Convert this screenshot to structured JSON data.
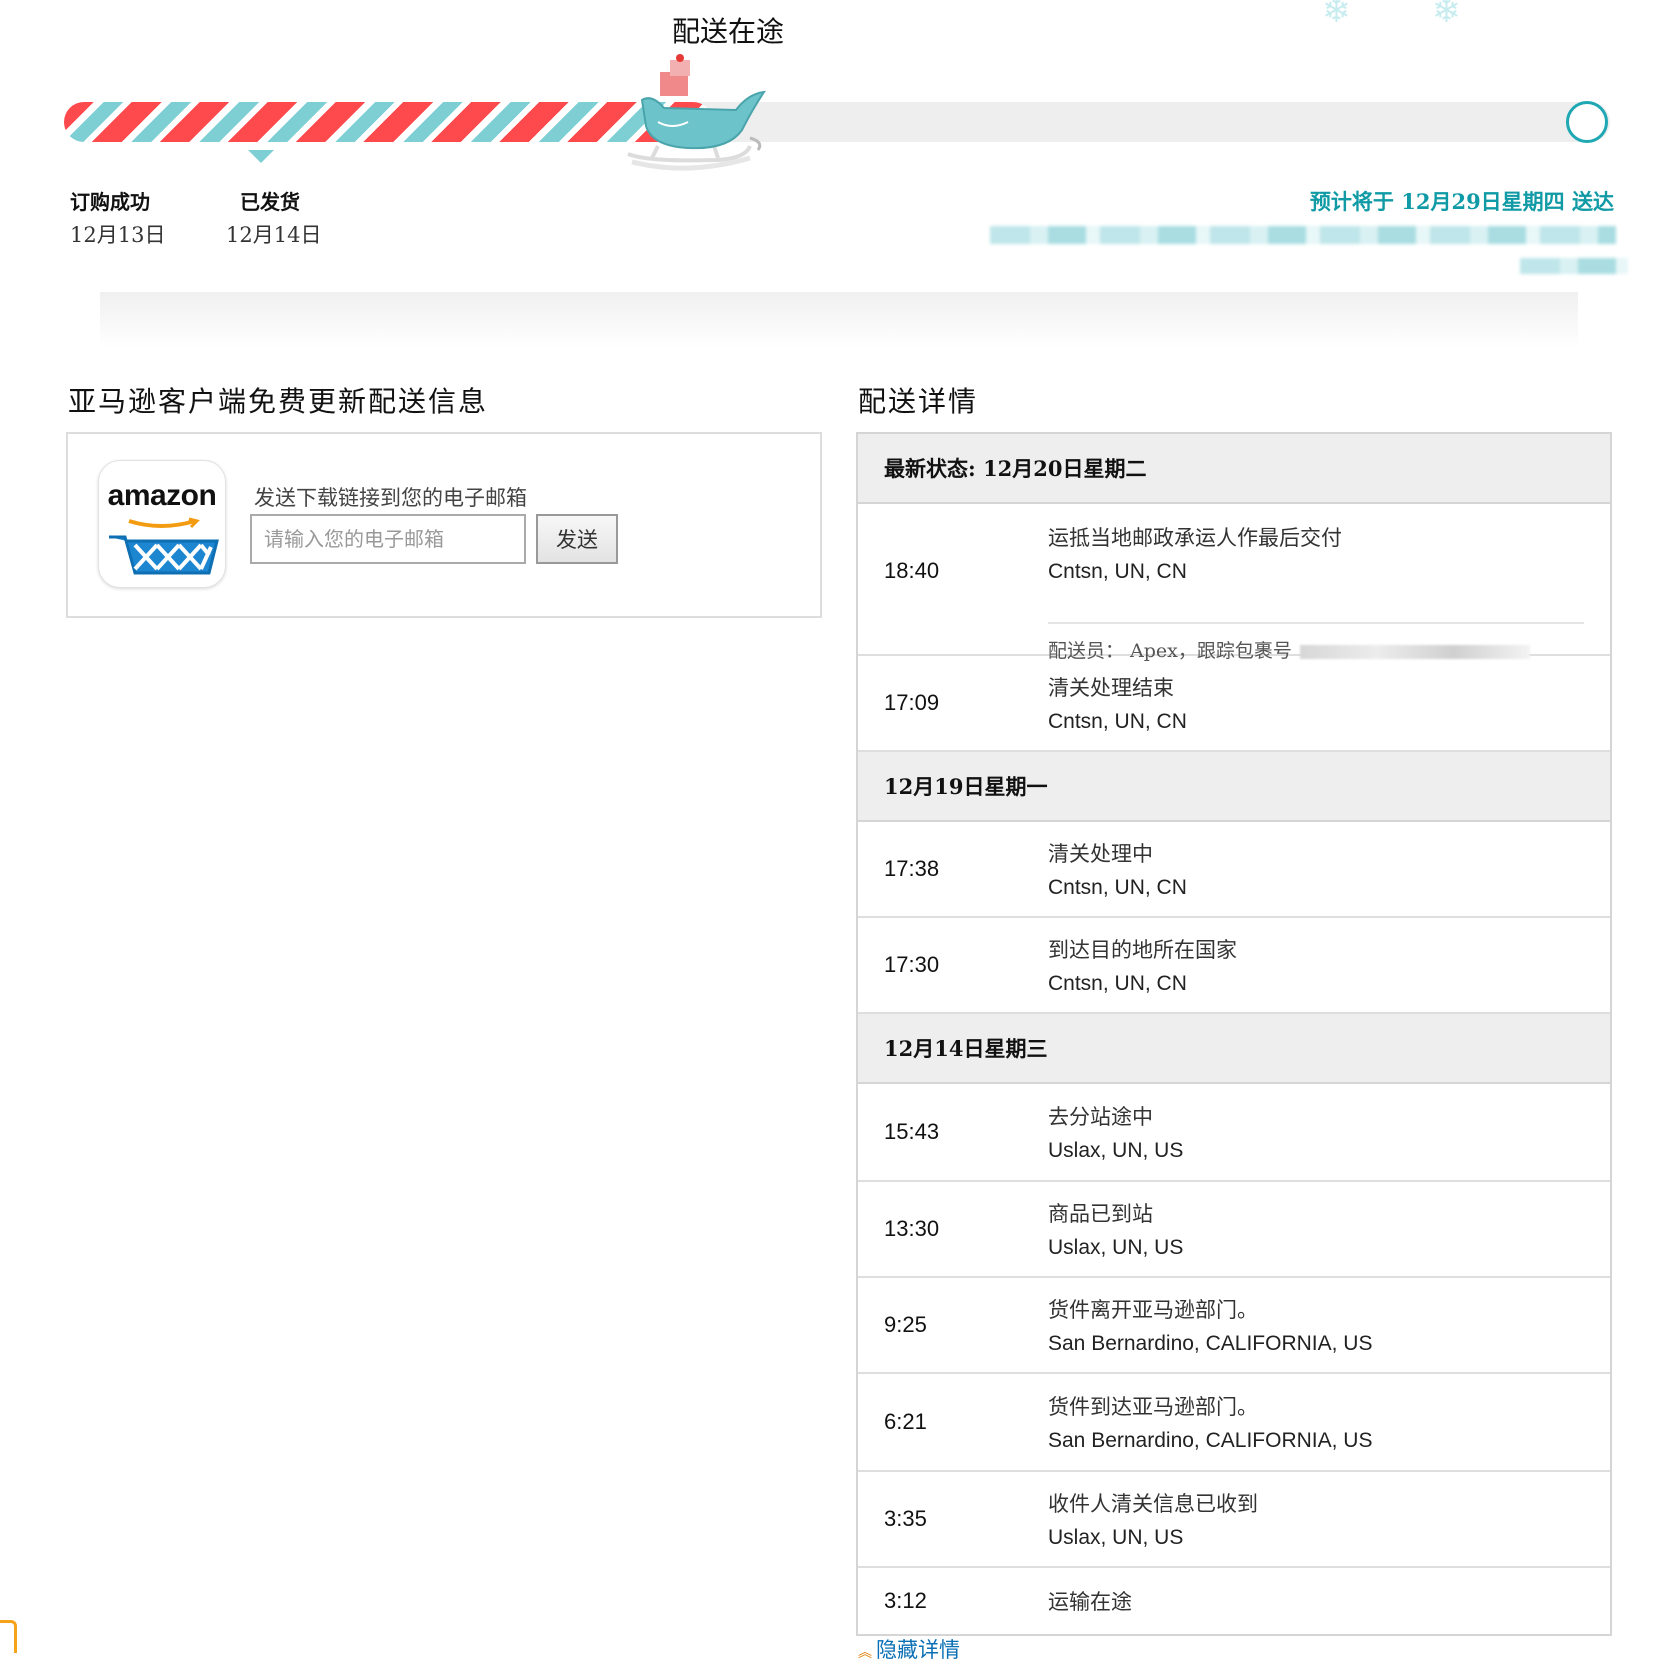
{
  "header": {
    "status_title": "配送在途",
    "progress": 0.42,
    "milestones": [
      {
        "label": "订购成功",
        "date": "12月13日"
      },
      {
        "label": "已发货",
        "date": "12月14日"
      }
    ],
    "eta": "预计将于 12月29日星期四 送达"
  },
  "colors": {
    "stripe_red": "#ff4a4d",
    "stripe_teal": "#7dcfd4",
    "accent_teal": "#0f9aa5",
    "link_blue": "#0a6fb5"
  },
  "app_promo": {
    "title": "亚马逊客户端免费更新配送信息",
    "logo_text": "amazon",
    "email_label": "发送下载链接到您的电子邮箱",
    "email_placeholder": "请输入您的电子邮箱",
    "send_button": "发送"
  },
  "tracking": {
    "title": "配送详情",
    "days": [
      {
        "header": "最新状态: 12月20日星期二",
        "events": [
          {
            "time": "18:40",
            "desc": "运抵当地邮政承运人作最后交付",
            "loc": "Cntsn, UN, CN",
            "courier": "配送员： Apex，跟踪包裹号"
          },
          {
            "time": "17:09",
            "desc": "清关处理结束",
            "loc": "Cntsn, UN, CN"
          }
        ]
      },
      {
        "header": "12月19日星期一",
        "events": [
          {
            "time": "17:38",
            "desc": "清关处理中",
            "loc": "Cntsn, UN, CN"
          },
          {
            "time": "17:30",
            "desc": "到达目的地所在国家",
            "loc": "Cntsn, UN, CN"
          }
        ]
      },
      {
        "header": "12月14日星期三",
        "events": [
          {
            "time": "15:43",
            "desc": "去分站途中",
            "loc": "Uslax, UN, US"
          },
          {
            "time": "13:30",
            "desc": "商品已到站",
            "loc": "Uslax, UN, US"
          },
          {
            "time": "9:25",
            "desc": "货件离开亚马逊部门。",
            "loc": "San Bernardino, CALIFORNIA, US"
          },
          {
            "time": "6:21",
            "desc": "货件到达亚马逊部门。",
            "loc": "San Bernardino, CALIFORNIA, US"
          },
          {
            "time": "3:35",
            "desc": "收件人清关信息已收到",
            "loc": "Uslax, UN, US"
          },
          {
            "time": "3:12",
            "desc": "运输在途"
          }
        ]
      }
    ],
    "hide_details": "隐藏详情"
  }
}
